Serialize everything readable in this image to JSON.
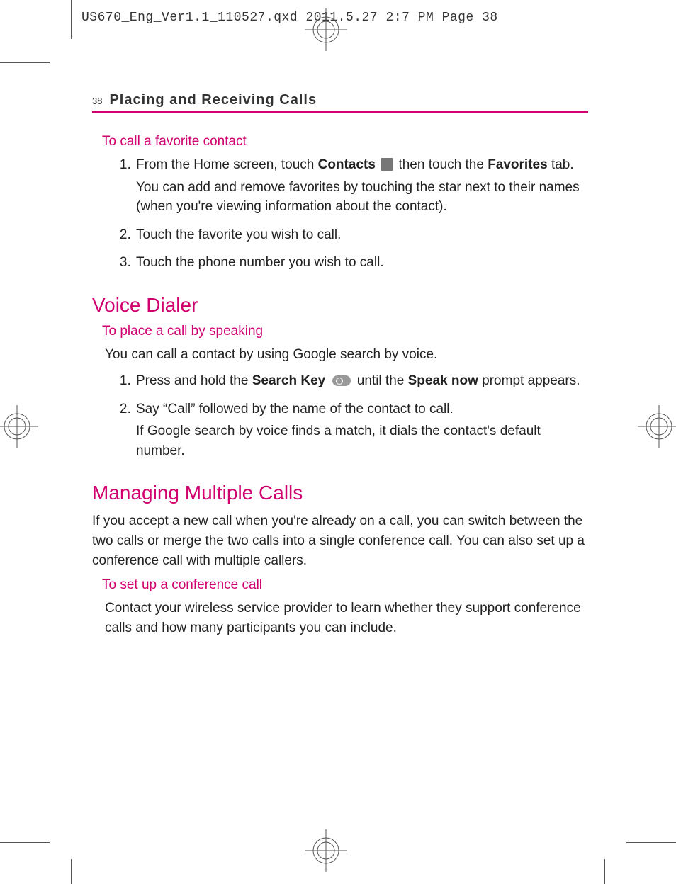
{
  "slug": "US670_Eng_Ver1.1_110527.qxd  2011.5.27  2:7 PM  Page 38",
  "page_number": "38",
  "chapter_title": "Placing and Receiving Calls",
  "sections": {
    "fav": {
      "title": "To call a favorite contact",
      "step1_a": "From the Home screen, touch ",
      "step1_b": "Contacts",
      "step1_c": " then touch the ",
      "step1_d": "Favorites",
      "step1_e": " tab.",
      "step1_note": "You can add and remove favorites by touching the star next to their names (when you're viewing information about the contact).",
      "step2": "Touch the favorite you wish to call.",
      "step3": "Touch the phone number you wish to call."
    },
    "voice": {
      "heading": "Voice Dialer",
      "sub": "To place a call by speaking",
      "intro": "You can call a contact by using Google search by voice.",
      "s1_a": "Press and hold the ",
      "s1_b": "Search Key",
      "s1_c": " until the ",
      "s1_d": "Speak now",
      "s1_e": " prompt appears.",
      "s2_a": "Say “Call” followed by the name of the contact to call.",
      "s2_b": "If Google search by voice finds a match, it dials the contact's default number."
    },
    "multi": {
      "heading": "Managing Multiple Calls",
      "intro": "If you accept a new call when you're already on a call, you can switch between the two calls or merge the two calls into a single conference call. You can also set up a conference call with multiple callers.",
      "sub": "To set up a conference call",
      "body": "Contact your wireless service provider to learn whether they support conference calls and how many participants you can include."
    }
  }
}
